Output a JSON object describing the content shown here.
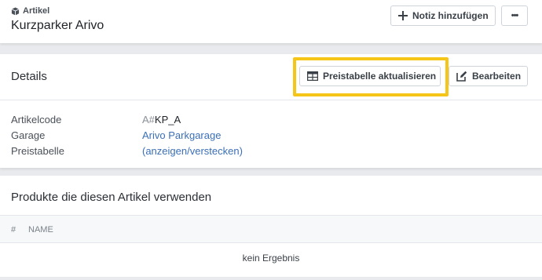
{
  "header": {
    "eyebrow": "Artikel",
    "title": "Kurzparker Arivo",
    "note_button": "Notiz hinzufügen",
    "more_button": "•••"
  },
  "details": {
    "title": "Details",
    "update_price_button": "Preistabelle aktualisieren",
    "edit_button": "Bearbeiten",
    "rows": [
      {
        "label": "Artikelcode",
        "value_prefix": "A#",
        "value": "KP_A"
      },
      {
        "label": "Garage",
        "value": "Arivo Parkgarage"
      },
      {
        "label": "Preistabelle",
        "value": "(anzeigen/verstecken)"
      }
    ]
  },
  "products": {
    "title": "Produkte die diesen Artikel verwenden",
    "columns": [
      "#",
      "NAME"
    ],
    "empty_text": "kein Ergebnis"
  },
  "colors": {
    "highlight": "#f5c518",
    "link": "#3b6fb6"
  },
  "icons": [
    "cube-icon",
    "plus-icon",
    "ellipsis-icon",
    "table-icon",
    "edit-icon"
  ]
}
